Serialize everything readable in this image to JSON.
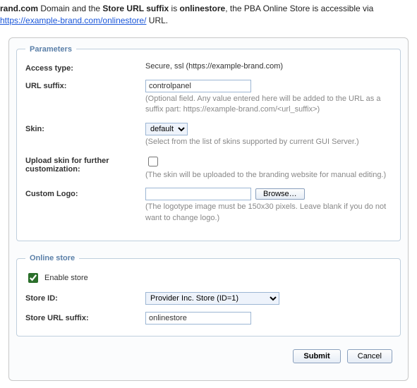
{
  "intro": {
    "prefix": "rand.com",
    "text1": " Domain and the ",
    "bold_store_url_suffix": "Store URL suffix",
    "text2": " is ",
    "bold_value": "onlinestore",
    "text3": ", the PBA Online Store is accessible via ",
    "url": "https://example-brand.com/onlinestore/",
    "text4": " URL."
  },
  "parameters_legend": "Parameters",
  "online_store_legend": "Online store",
  "params": {
    "access_type_label": "Access type:",
    "access_type_value": "Secure, ssl (https://example-brand.com)",
    "url_suffix_label": "URL suffix:",
    "url_suffix_value": "controlpanel",
    "url_suffix_hint": "(Optional field. Any value entered here will be added to the URL as a suffix part: https://example-brand.com/<url_suffix>)",
    "skin_label": "Skin:",
    "skin_value": "default",
    "skin_hint": "(Select from the list of skins supported by current GUI Server.)",
    "upload_skin_label": "Upload skin for further customization:",
    "upload_skin_checked": false,
    "upload_skin_hint": "(The skin will be uploaded to the branding website for manual editing.)",
    "custom_logo_label": "Custom Logo:",
    "custom_logo_value": "",
    "browse_label": "Browse…",
    "custom_logo_hint": "(The logotype image must be 150x30 pixels. Leave blank if you do not want to change logo.)"
  },
  "store": {
    "enable_label": "Enable store",
    "enable_checked": true,
    "store_id_label": "Store ID:",
    "store_id_value": "Provider Inc. Store (ID=1)",
    "store_url_suffix_label": "Store URL suffix:",
    "store_url_suffix_value": "onlinestore"
  },
  "buttons": {
    "submit": "Submit",
    "cancel": "Cancel"
  }
}
